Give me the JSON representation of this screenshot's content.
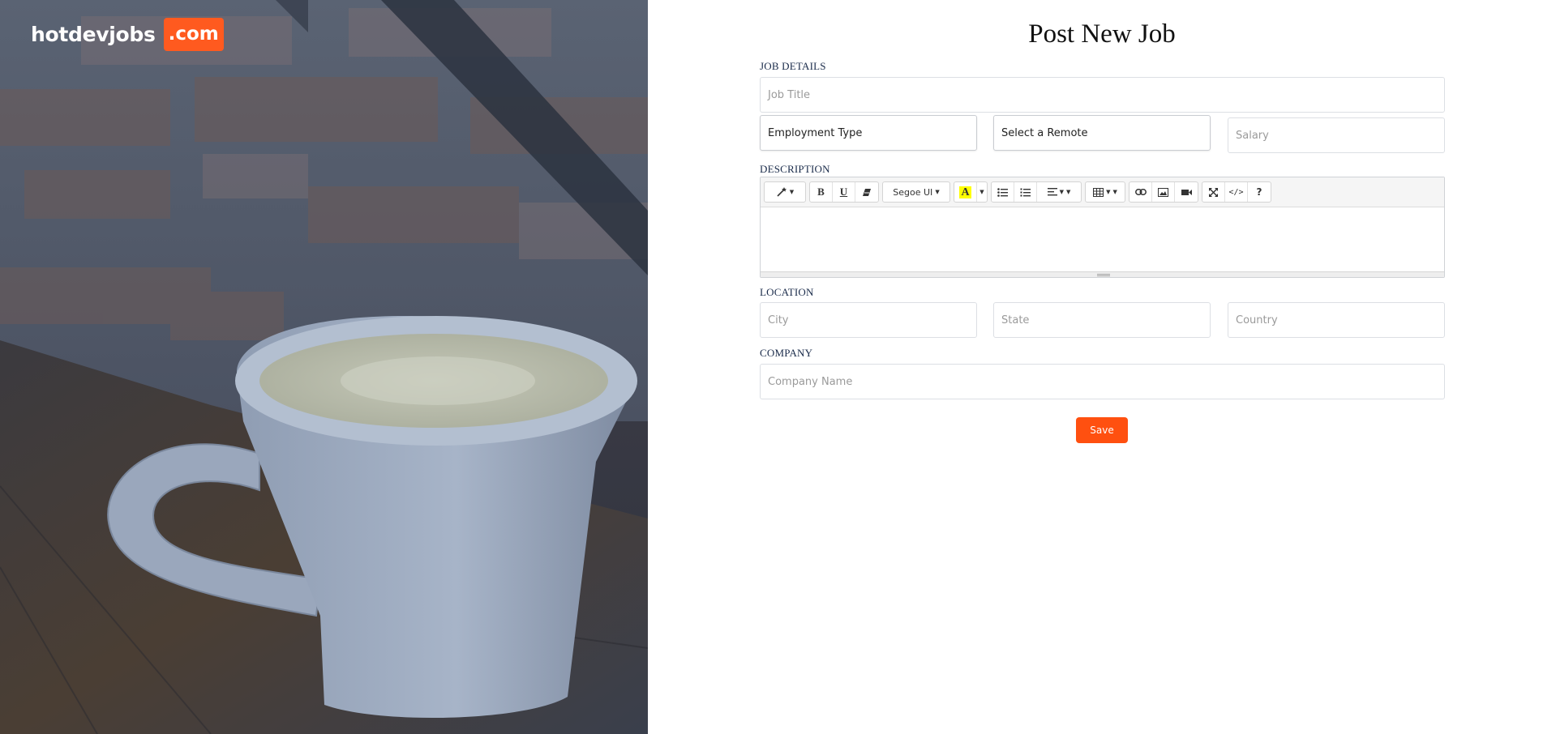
{
  "brand": {
    "name": "hotdevjobs",
    "tld": ".com",
    "accent_color": "#ff5a1f"
  },
  "page": {
    "title": "Post New Job"
  },
  "sections": {
    "job_details": "JOB DETAILS",
    "description": "DESCRIPTION",
    "location": "LOCATION",
    "company": "COMPANY"
  },
  "fields": {
    "job_title": {
      "placeholder": "Job Title",
      "value": ""
    },
    "employment_type": {
      "selected": "Employment Type"
    },
    "remote": {
      "selected": "Select a Remote"
    },
    "salary": {
      "placeholder": "Salary",
      "value": ""
    },
    "city": {
      "placeholder": "City",
      "value": ""
    },
    "state": {
      "placeholder": "State",
      "value": ""
    },
    "country": {
      "placeholder": "Country",
      "value": ""
    },
    "company_name": {
      "placeholder": "Company Name",
      "value": ""
    }
  },
  "editor": {
    "font_name": "Segoe UI",
    "toolbar_icons": [
      "magic-wand-icon",
      "bold-icon",
      "underline-icon",
      "eraser-icon",
      "font-name-dropdown",
      "text-color-icon",
      "unordered-list-icon",
      "ordered-list-icon",
      "align-icon",
      "table-icon",
      "link-icon",
      "picture-icon",
      "video-icon",
      "fullscreen-icon",
      "code-view-icon",
      "help-icon"
    ],
    "content": ""
  },
  "actions": {
    "save_label": "Save",
    "save_color": "#ff5010"
  }
}
